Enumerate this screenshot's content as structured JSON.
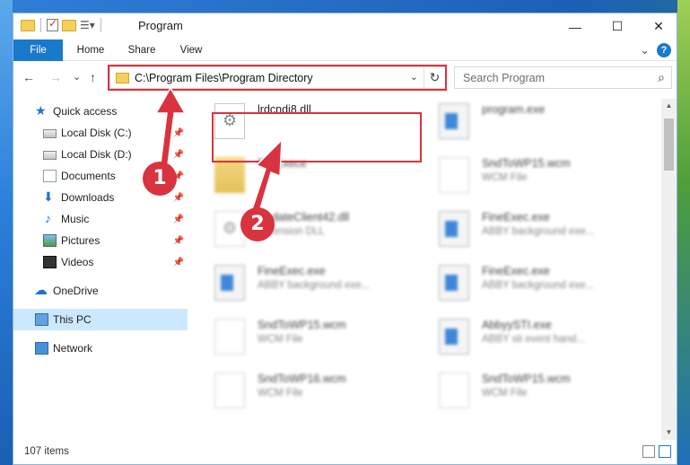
{
  "window": {
    "title": "Program"
  },
  "window_controls": {
    "minimize": "—",
    "maximize": "☐",
    "close": "✕"
  },
  "ribbon": {
    "tabs": [
      "File",
      "Home",
      "Share",
      "View"
    ],
    "expand": "⌄",
    "help": "?"
  },
  "nav": {
    "back": "←",
    "forward": "→",
    "recent": "⌄",
    "up": "↑",
    "address": "C:\\Program Files\\Program Directory",
    "address_dropdown": "⌄",
    "refresh": "↻",
    "search_placeholder": "Search Program",
    "search_icon": "⌕"
  },
  "sidebar": {
    "items": [
      {
        "label": "Quick access",
        "icon": "star-icon",
        "pinned": false
      },
      {
        "label": "Local Disk (C:)",
        "icon": "drive-icon",
        "pinned": true
      },
      {
        "label": "Local Disk (D:)",
        "icon": "drive-icon",
        "pinned": true
      },
      {
        "label": "Documents",
        "icon": "documents-icon",
        "pinned": true
      },
      {
        "label": "Downloads",
        "icon": "download-icon",
        "pinned": true
      },
      {
        "label": "Music",
        "icon": "music-icon",
        "pinned": true
      },
      {
        "label": "Pictures",
        "icon": "pictures-icon",
        "pinned": true
      },
      {
        "label": "Videos",
        "icon": "videos-icon",
        "pinned": true
      },
      {
        "label": "OneDrive",
        "icon": "onedrive-icon",
        "pinned": false
      },
      {
        "label": "This PC",
        "icon": "this-pc-icon",
        "pinned": false,
        "selected": true
      },
      {
        "label": "Network",
        "icon": "network-icon",
        "pinned": false
      }
    ],
    "pin_glyph": "📌",
    "glyphs": {
      "star": "★",
      "download": "⬇",
      "music": "♪",
      "cloud": "☁"
    }
  },
  "files": [
    {
      "name": "lrdcndi8.dll",
      "type": "",
      "icon": "dll",
      "highlighted": true
    },
    {
      "name": "program.exe",
      "type": "",
      "icon": "exe"
    },
    {
      "name": "FileExece",
      "type": "",
      "icon": "folder"
    },
    {
      "name": "SndToWP15.wcm",
      "type": "WCM File",
      "icon": "file"
    },
    {
      "name": "UpdateClient42.dll",
      "type": "Extension DLL",
      "icon": "dll"
    },
    {
      "name": "FineExec.exe",
      "type": "ABBY background exe...",
      "icon": "exe"
    },
    {
      "name": "FineExec.exe",
      "type": "ABBY background exe...",
      "icon": "exe"
    },
    {
      "name": "FineExec.exe",
      "type": "ABBY background exe...",
      "icon": "exe"
    },
    {
      "name": "SndToWP15.wcm",
      "type": "WCM File",
      "icon": "file"
    },
    {
      "name": "AbbyySTI.exe",
      "type": "ABBY sti event hand...",
      "icon": "exe"
    },
    {
      "name": "SndToWP16.wcm",
      "type": "WCM File",
      "icon": "file"
    },
    {
      "name": "SndToWP15.wcm",
      "type": "WCM File",
      "icon": "file"
    }
  ],
  "status": {
    "item_count": "107 items"
  },
  "scrollbar": {
    "up": "▲",
    "down": "▼"
  },
  "callouts": [
    "1",
    "2"
  ],
  "colors": {
    "accent": "#1979ca",
    "highlight_red": "#d9333f",
    "selected_bg": "#cce8ff"
  }
}
